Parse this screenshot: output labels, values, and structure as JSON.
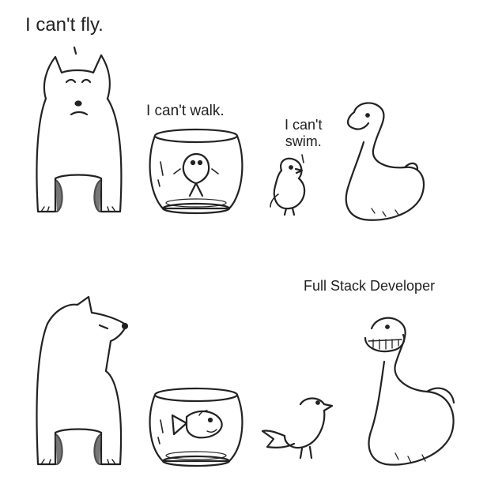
{
  "captions": {
    "dog": "I can't fly.",
    "fish": "I can't walk.",
    "chick": "I can't\nswim.",
    "duck": "Full Stack Developer"
  }
}
